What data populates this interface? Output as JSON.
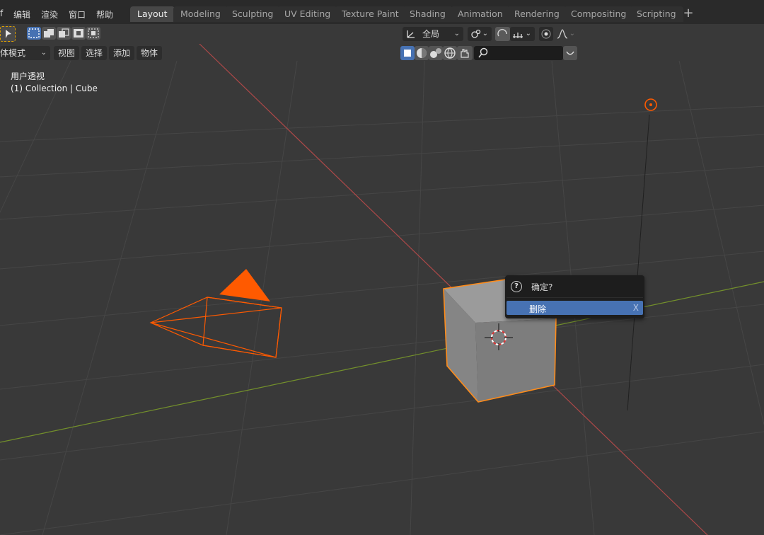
{
  "menu": {
    "file_partial": "f",
    "edit": "编辑",
    "render": "渲染",
    "window": "窗口",
    "help": "帮助"
  },
  "workspace_tabs": {
    "layout": "Layout",
    "modeling": "Modeling",
    "sculpting": "Sculpting",
    "uv_editing": "UV Editing",
    "texture_paint": "Texture Paint",
    "shading": "Shading",
    "animation": "Animation",
    "rendering": "Rendering",
    "compositing": "Compositing",
    "scripting": "Scripting",
    "add": "+"
  },
  "toolbar": {
    "transform_orientation": "全局"
  },
  "viewport_header": {
    "mode_partial": "体模式",
    "view": "视图",
    "select": "选择",
    "add": "添加",
    "object": "物体",
    "search_icon": "search-icon"
  },
  "overlay": {
    "view_name": "用户透视",
    "collection_info": "(1) Collection | Cube"
  },
  "confirm_popup": {
    "title": "确定?",
    "item_label": "删除",
    "item_shortcut": "X"
  },
  "colors": {
    "accent_selection": "#4772b3",
    "selected_object_outline": "#ff8c1a",
    "camera_orange": "#ff5a00",
    "axis_x_red": "#c24b4b",
    "axis_y_green": "#7a9a2a"
  }
}
